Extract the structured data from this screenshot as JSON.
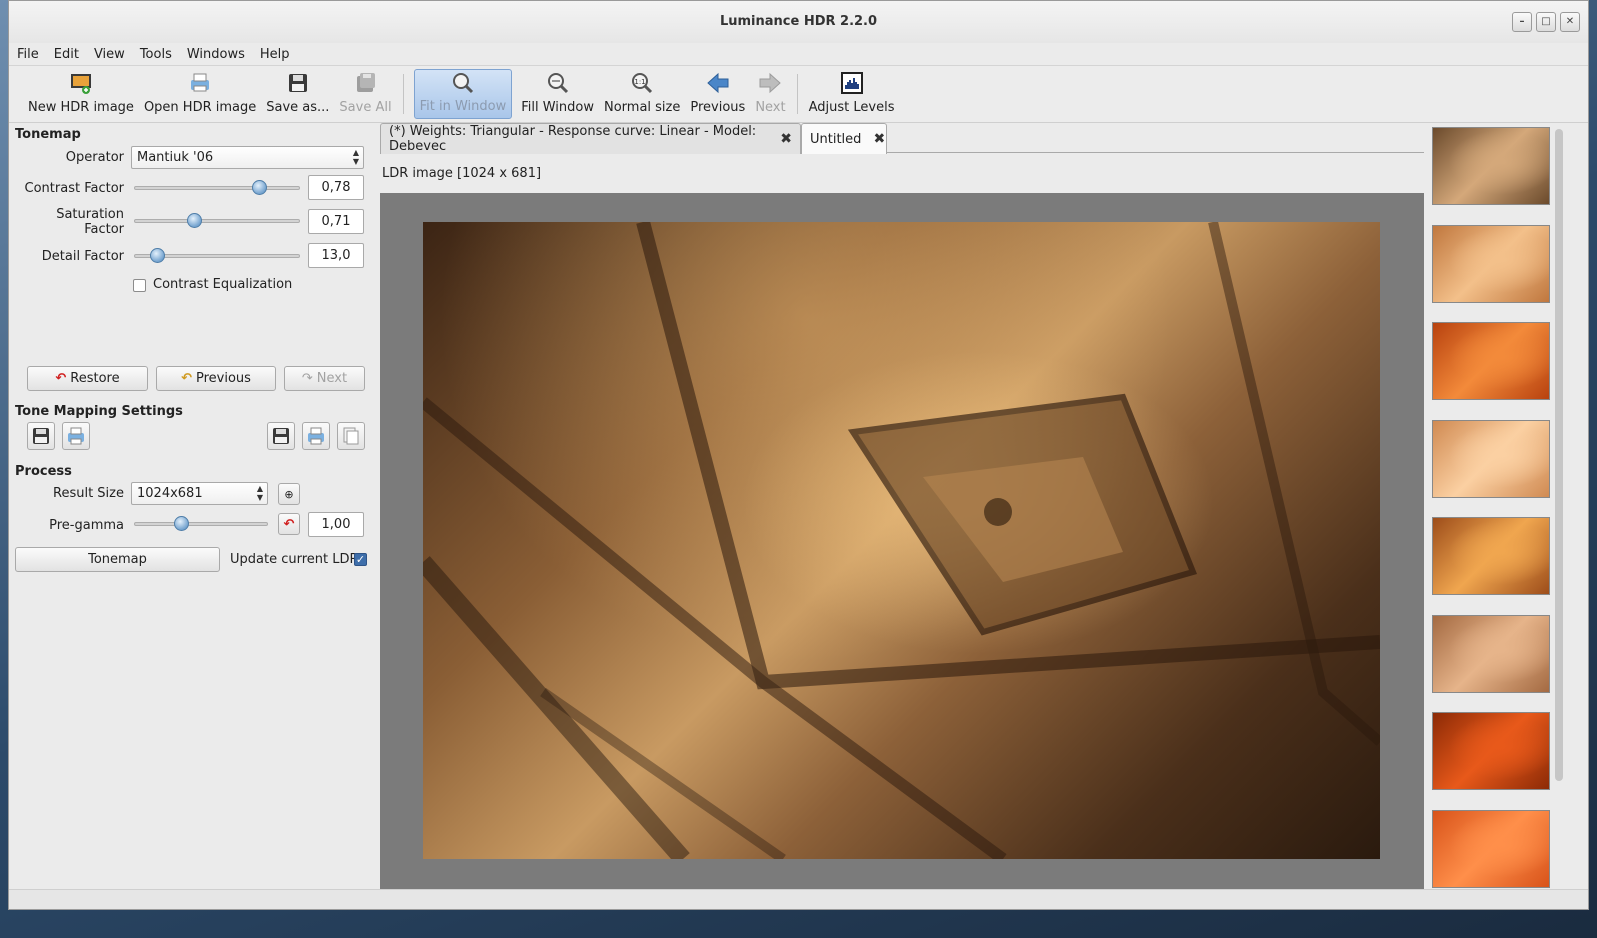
{
  "window": {
    "title": "Luminance HDR 2.2.0",
    "ctrl_minimize": "–",
    "ctrl_maximize": "□",
    "ctrl_close": "✕"
  },
  "menu": [
    "File",
    "Edit",
    "View",
    "Tools",
    "Windows",
    "Help"
  ],
  "toolbar": {
    "new_hdr": "New HDR image",
    "open_hdr": "Open HDR image",
    "save_as": "Save as...",
    "save_all": "Save All",
    "fit_window": "Fit in Window",
    "fill_window": "Fill Window",
    "normal_size": "Normal size",
    "previous": "Previous",
    "next": "Next",
    "adjust_levels": "Adjust Levels"
  },
  "tonemap": {
    "title": "Tonemap",
    "operator_label": "Operator",
    "operator_value": "Mantiuk '06",
    "contrast_label": "Contrast Factor",
    "contrast_value": "0,78",
    "contrast_level": 0.75,
    "saturation_label_1": "Saturation",
    "saturation_label_2": "Factor",
    "saturation_value": "0,71",
    "saturation_level": 0.36,
    "detail_label": "Detail Factor",
    "detail_value": "13,0",
    "detail_level": 0.14,
    "equalization_label": "Contrast Equalization",
    "equalization_checked": false,
    "restore": "Restore",
    "previous": "Previous",
    "next": "Next"
  },
  "settings": {
    "title": "Tone Mapping Settings"
  },
  "process": {
    "title": "Process",
    "result_label": "Result Size",
    "result_value": "1024x681",
    "pregamma_label": "Pre-gamma",
    "pregamma_value": "1,00",
    "pregamma_level": 0.35,
    "tonemap_button": "Tonemap",
    "update_label": "Update current LDR",
    "update_checked": true
  },
  "tabs": [
    {
      "label": "(*) Weights: Triangular - Response curve: Linear - Model: Debevec",
      "active": false
    },
    {
      "label": "Untitled",
      "active": true
    }
  ],
  "image_caption": "LDR image [1024 x 681]",
  "thumbnails": [
    {
      "base": "#6b4a2c",
      "light": "#d4a87a"
    },
    {
      "base": "#c0773e",
      "light": "#f3c08a"
    },
    {
      "base": "#b8420f",
      "light": "#f38a3a"
    },
    {
      "base": "#d08a52",
      "light": "#fbd0a2"
    },
    {
      "base": "#9d4d1a",
      "light": "#f0a64f"
    },
    {
      "base": "#a46a42",
      "light": "#e6b48a"
    },
    {
      "base": "#8c2a06",
      "light": "#e8591a"
    },
    {
      "base": "#d8531a",
      "light": "#ff8f4a"
    }
  ]
}
